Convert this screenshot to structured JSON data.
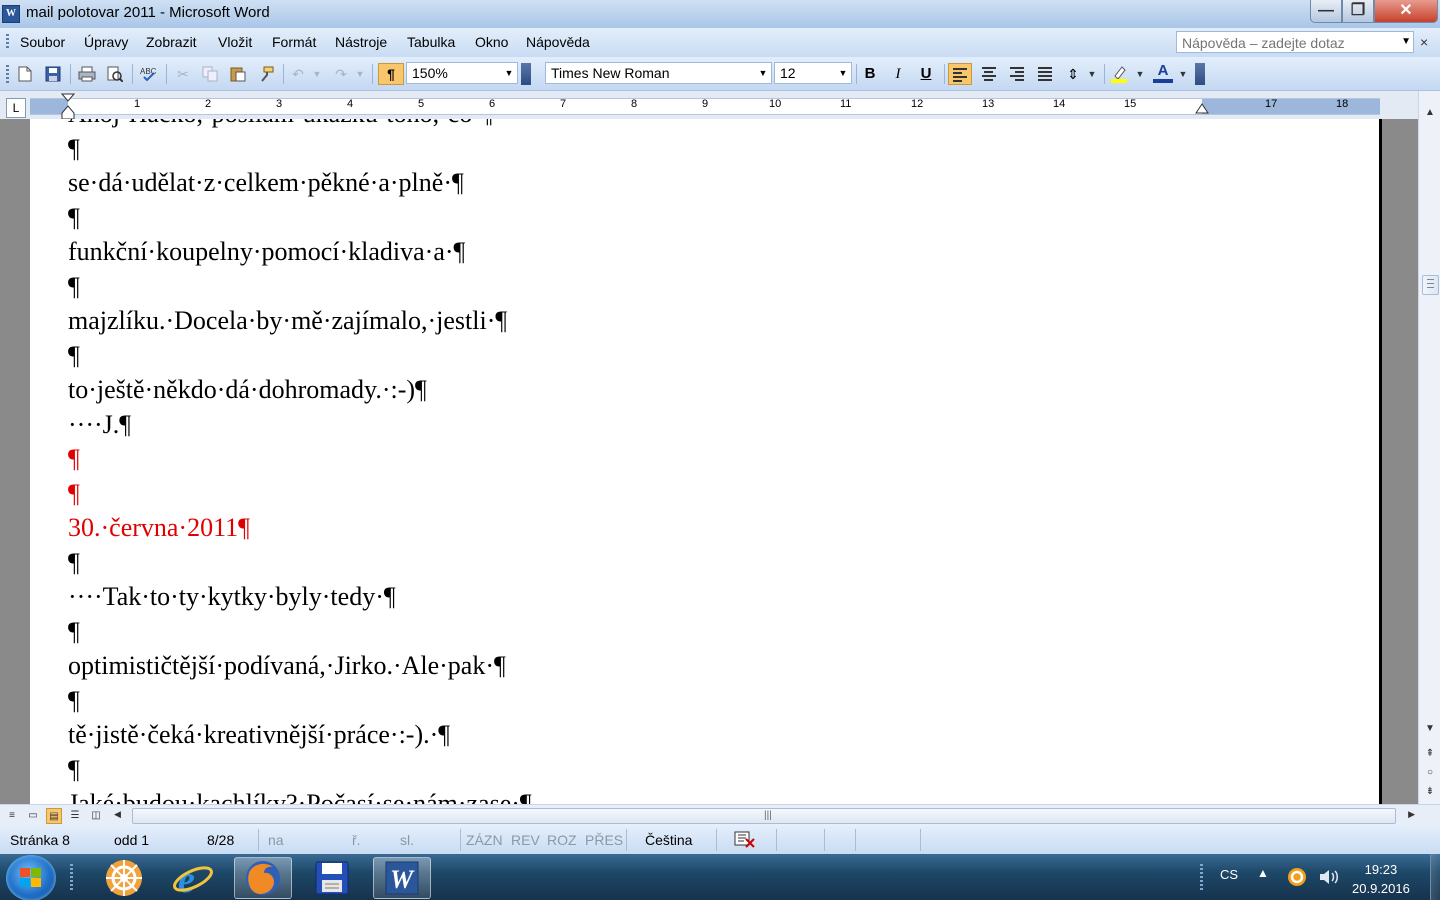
{
  "window": {
    "title": "mail polotovar 2011 - Microsoft Word",
    "app_icon_letter": "W",
    "minimize_glyph": "—",
    "maximize_glyph": "❐",
    "close_glyph": "✕"
  },
  "menu": {
    "items": [
      "Soubor",
      "Úpravy",
      "Zobrazit",
      "Vložit",
      "Formát",
      "Nástroje",
      "Tabulka",
      "Okno",
      "Nápověda"
    ],
    "help_placeholder": "Nápověda – zadejte dotaz",
    "close_glyph": "×"
  },
  "toolbar": {
    "zoom": "150%",
    "font_name": "Times New Roman",
    "font_size": "12",
    "bold_label": "B",
    "italic_label": "I",
    "underline_label": "U",
    "font_color_label": "A",
    "pilcrow": "¶",
    "accent_color": "#f9c66b"
  },
  "ruler": {
    "corner_label": "L",
    "numbers": [
      "1",
      "2",
      "3",
      "4",
      "5",
      "6",
      "7",
      "8",
      "9",
      "10",
      "11",
      "12",
      "13",
      "14",
      "15",
      "17",
      "18"
    ]
  },
  "document": {
    "paragraphs": [
      {
        "text": "Ahoj·Hačko,·posílám·ukázku·toho,·co·¶",
        "color": "black"
      },
      {
        "text": "¶",
        "color": "black"
      },
      {
        "text": "se·dá·udělat·z·celkem·pěkné·a·plně·¶",
        "color": "black"
      },
      {
        "text": "¶",
        "color": "black"
      },
      {
        "text": "funkční·koupelny·pomocí·kladiva·a·¶",
        "color": "black"
      },
      {
        "text": "¶",
        "color": "black"
      },
      {
        "text": "majzlíku.·Docela·by·mě·zajímalo,·jestli·¶",
        "color": "black"
      },
      {
        "text": "¶",
        "color": "black"
      },
      {
        "text": "to·ještě·někdo·dá·dohromady.·:-)¶",
        "color": "black"
      },
      {
        "text": "····J.¶",
        "color": "black"
      },
      {
        "text": "¶",
        "color": "red"
      },
      {
        "text": "¶",
        "color": "red"
      },
      {
        "text": "30.·června·2011¶",
        "color": "red"
      },
      {
        "text": "¶",
        "color": "black"
      },
      {
        "text": "····Tak·to·ty·kytky·byly·tedy·¶",
        "color": "black"
      },
      {
        "text": "¶",
        "color": "black"
      },
      {
        "text": "optimističtější·podívaná,·Jirko.·Ale·pak·¶",
        "color": "black"
      },
      {
        "text": "¶",
        "color": "black"
      },
      {
        "text": "tě·jistě·čeká·kreativnější·práce·:-).·¶",
        "color": "black"
      },
      {
        "text": "¶",
        "color": "black"
      },
      {
        "text": "Jaké·budou·kachlíky?·Počasí·se·nám·zase·¶",
        "color": "black"
      }
    ],
    "text_color": "#000000",
    "highlight_red": "#e00000"
  },
  "statusbar": {
    "page": "Stránka 8",
    "section": "odd 1",
    "pages": "8/28",
    "at": "na",
    "line": "ř.",
    "col": "sl.",
    "rec": "ZÁZN",
    "rev": "REV",
    "ext": "ROZ",
    "ovr": "PŘES",
    "language": "Čeština"
  },
  "taskbar": {
    "language": "CS",
    "time": "19:23",
    "date": "20.9.2016",
    "apps": [
      "helm-app-icon",
      "internet-explorer-icon",
      "firefox-icon",
      "floppy-save-icon",
      "word-icon"
    ]
  }
}
